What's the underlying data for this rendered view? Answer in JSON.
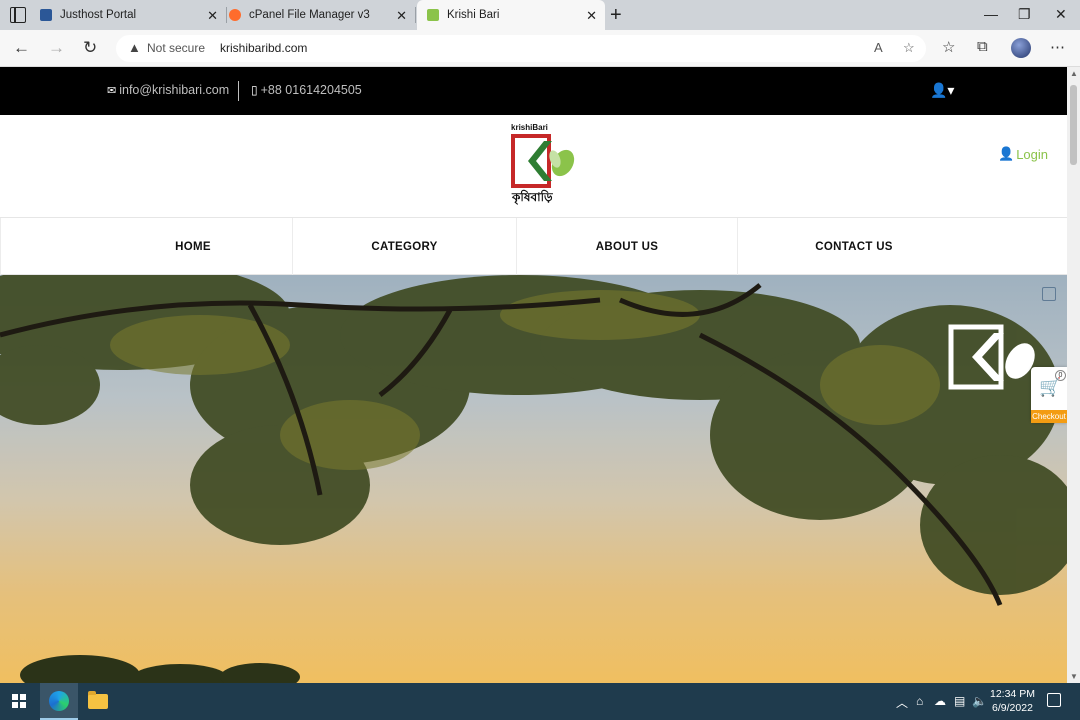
{
  "browser": {
    "tabs": [
      {
        "title": "Justhost Portal",
        "icon": "justhost-favicon",
        "color": "#2b5797"
      },
      {
        "title": "cPanel File Manager v3",
        "icon": "cpanel-favicon",
        "color": "#ff6c2c"
      },
      {
        "title": "Krishi Bari",
        "icon": "krishibari-favicon",
        "color": "#8bc34a"
      }
    ],
    "security_label": "Not secure",
    "url": "krishibaribd.com"
  },
  "site": {
    "email": "info@krishibari.com",
    "phone": "+88 01614204505",
    "login_label": "Login",
    "logo_text": "krishiBari",
    "logo_bn": "কৃষিবাড়ি",
    "nav": [
      "HOME",
      "CATEGORY",
      "ABOUT US",
      "CONTACT US"
    ],
    "cart_count": "0",
    "checkout_label": "Checkout",
    "accent": "#8bc34a",
    "brand_red": "#c62828",
    "brand_green": "#2e7d32"
  },
  "taskbar": {
    "time": "12:34 PM",
    "date": "6/9/2022"
  }
}
